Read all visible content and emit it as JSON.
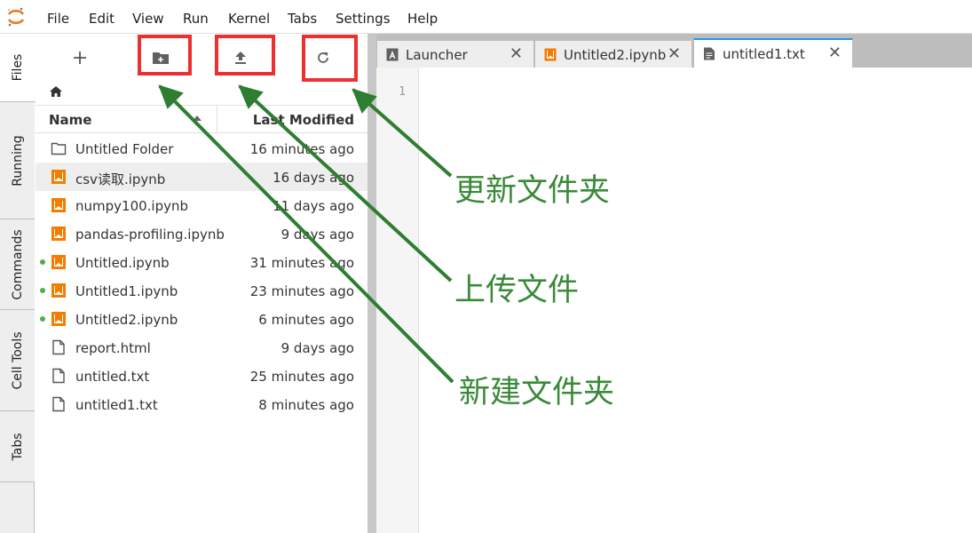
{
  "menubar": {
    "items": [
      "File",
      "Edit",
      "View",
      "Run",
      "Kernel",
      "Tabs",
      "Settings",
      "Help"
    ]
  },
  "left_tabs": [
    "Files",
    "Running",
    "Commands",
    "Cell Tools",
    "Tabs"
  ],
  "file_browser": {
    "toolbar": {
      "new_launcher": "plus-icon",
      "new_folder": "new-folder-icon",
      "upload": "upload-icon",
      "refresh": "refresh-icon"
    },
    "breadcrumb_icon": "home-icon",
    "columns": {
      "name": "Name",
      "modified": "Last Modified"
    },
    "files": [
      {
        "name": "Untitled Folder",
        "modified": "16 minutes ago",
        "type": "folder",
        "running": false,
        "selected": false
      },
      {
        "name": "csv读取.ipynb",
        "modified": "16 days ago",
        "type": "notebook",
        "running": false,
        "selected": true
      },
      {
        "name": "numpy100.ipynb",
        "modified": "11 days ago",
        "type": "notebook",
        "running": false,
        "selected": false
      },
      {
        "name": "pandas-profiling.ipynb",
        "modified": "9 days ago",
        "type": "notebook",
        "running": false,
        "selected": false
      },
      {
        "name": "Untitled.ipynb",
        "modified": "31 minutes ago",
        "type": "notebook",
        "running": true,
        "selected": false
      },
      {
        "name": "Untitled1.ipynb",
        "modified": "23 minutes ago",
        "type": "notebook",
        "running": true,
        "selected": false
      },
      {
        "name": "Untitled2.ipynb",
        "modified": "6 minutes ago",
        "type": "notebook",
        "running": true,
        "selected": false
      },
      {
        "name": "report.html",
        "modified": "9 days ago",
        "type": "file",
        "running": false,
        "selected": false
      },
      {
        "name": "untitled.txt",
        "modified": "25 minutes ago",
        "type": "file",
        "running": false,
        "selected": false
      },
      {
        "name": "untitled1.txt",
        "modified": "8 minutes ago",
        "type": "file",
        "running": false,
        "selected": false
      }
    ]
  },
  "doc_tabs": [
    {
      "label": "Launcher",
      "icon": "launcher-icon",
      "active": false
    },
    {
      "label": "Untitled2.ipynb",
      "icon": "notebook-icon",
      "active": false
    },
    {
      "label": "untitled1.txt",
      "icon": "text-file-icon",
      "active": true
    }
  ],
  "editor": {
    "line_number": "1"
  },
  "annotations": {
    "refresh": "更新文件夹",
    "upload": "上传文件",
    "new_folder": "新建文件夹"
  },
  "colors": {
    "highlight": "#ee2f2f",
    "annotation": "#3a8a3a",
    "notebook": "#f57c00",
    "running_dot": "#4caf50",
    "active_tab": "#2196f3"
  }
}
